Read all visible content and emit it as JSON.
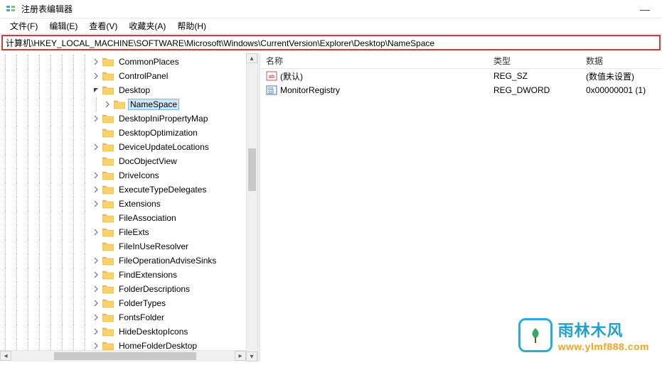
{
  "titlebar": {
    "title": "注册表编辑器"
  },
  "menu": {
    "file": "文件(F)",
    "edit": "编辑(E)",
    "view": "查看(V)",
    "favorites": "收藏夹(A)",
    "help": "帮助(H)"
  },
  "addressbar": {
    "path": "计算机\\HKEY_LOCAL_MACHINE\\SOFTWARE\\Microsoft\\Windows\\CurrentVersion\\Explorer\\Desktop\\NameSpace"
  },
  "tree": {
    "items": [
      {
        "label": "CommonPlaces",
        "depth": 8,
        "chevron": ">",
        "selected": false
      },
      {
        "label": "ControlPanel",
        "depth": 8,
        "chevron": ">",
        "selected": false
      },
      {
        "label": "Desktop",
        "depth": 8,
        "chevron": "v",
        "selected": false
      },
      {
        "label": "NameSpace",
        "depth": 9,
        "chevron": ">",
        "selected": true
      },
      {
        "label": "DesktopIniPropertyMap",
        "depth": 8,
        "chevron": ">",
        "selected": false
      },
      {
        "label": "DesktopOptimization",
        "depth": 8,
        "chevron": "",
        "selected": false
      },
      {
        "label": "DeviceUpdateLocations",
        "depth": 8,
        "chevron": ">",
        "selected": false
      },
      {
        "label": "DocObjectView",
        "depth": 8,
        "chevron": "",
        "selected": false
      },
      {
        "label": "DriveIcons",
        "depth": 8,
        "chevron": ">",
        "selected": false
      },
      {
        "label": "ExecuteTypeDelegates",
        "depth": 8,
        "chevron": ">",
        "selected": false
      },
      {
        "label": "Extensions",
        "depth": 8,
        "chevron": ">",
        "selected": false
      },
      {
        "label": "FileAssociation",
        "depth": 8,
        "chevron": "",
        "selected": false
      },
      {
        "label": "FileExts",
        "depth": 8,
        "chevron": ">",
        "selected": false
      },
      {
        "label": "FileInUseResolver",
        "depth": 8,
        "chevron": "",
        "selected": false
      },
      {
        "label": "FileOperationAdviseSinks",
        "depth": 8,
        "chevron": ">",
        "selected": false
      },
      {
        "label": "FindExtensions",
        "depth": 8,
        "chevron": ">",
        "selected": false
      },
      {
        "label": "FolderDescriptions",
        "depth": 8,
        "chevron": ">",
        "selected": false
      },
      {
        "label": "FolderTypes",
        "depth": 8,
        "chevron": ">",
        "selected": false
      },
      {
        "label": "FontsFolder",
        "depth": 8,
        "chevron": ">",
        "selected": false
      },
      {
        "label": "HideDesktopIcons",
        "depth": 8,
        "chevron": ">",
        "selected": false
      },
      {
        "label": "HomeFolderDesktop",
        "depth": 8,
        "chevron": ">",
        "selected": false
      }
    ]
  },
  "list": {
    "headers": {
      "name": "名称",
      "type": "类型",
      "data": "数据"
    },
    "rows": [
      {
        "iconType": "sz",
        "name": "(默认)",
        "type": "REG_SZ",
        "data": "(数值未设置)"
      },
      {
        "iconType": "dw",
        "name": "MonitorRegistry",
        "type": "REG_DWORD",
        "data": "0x00000001 (1)"
      }
    ]
  },
  "watermark": {
    "cn": "雨林木风",
    "url": "www.ylmf888.com"
  }
}
